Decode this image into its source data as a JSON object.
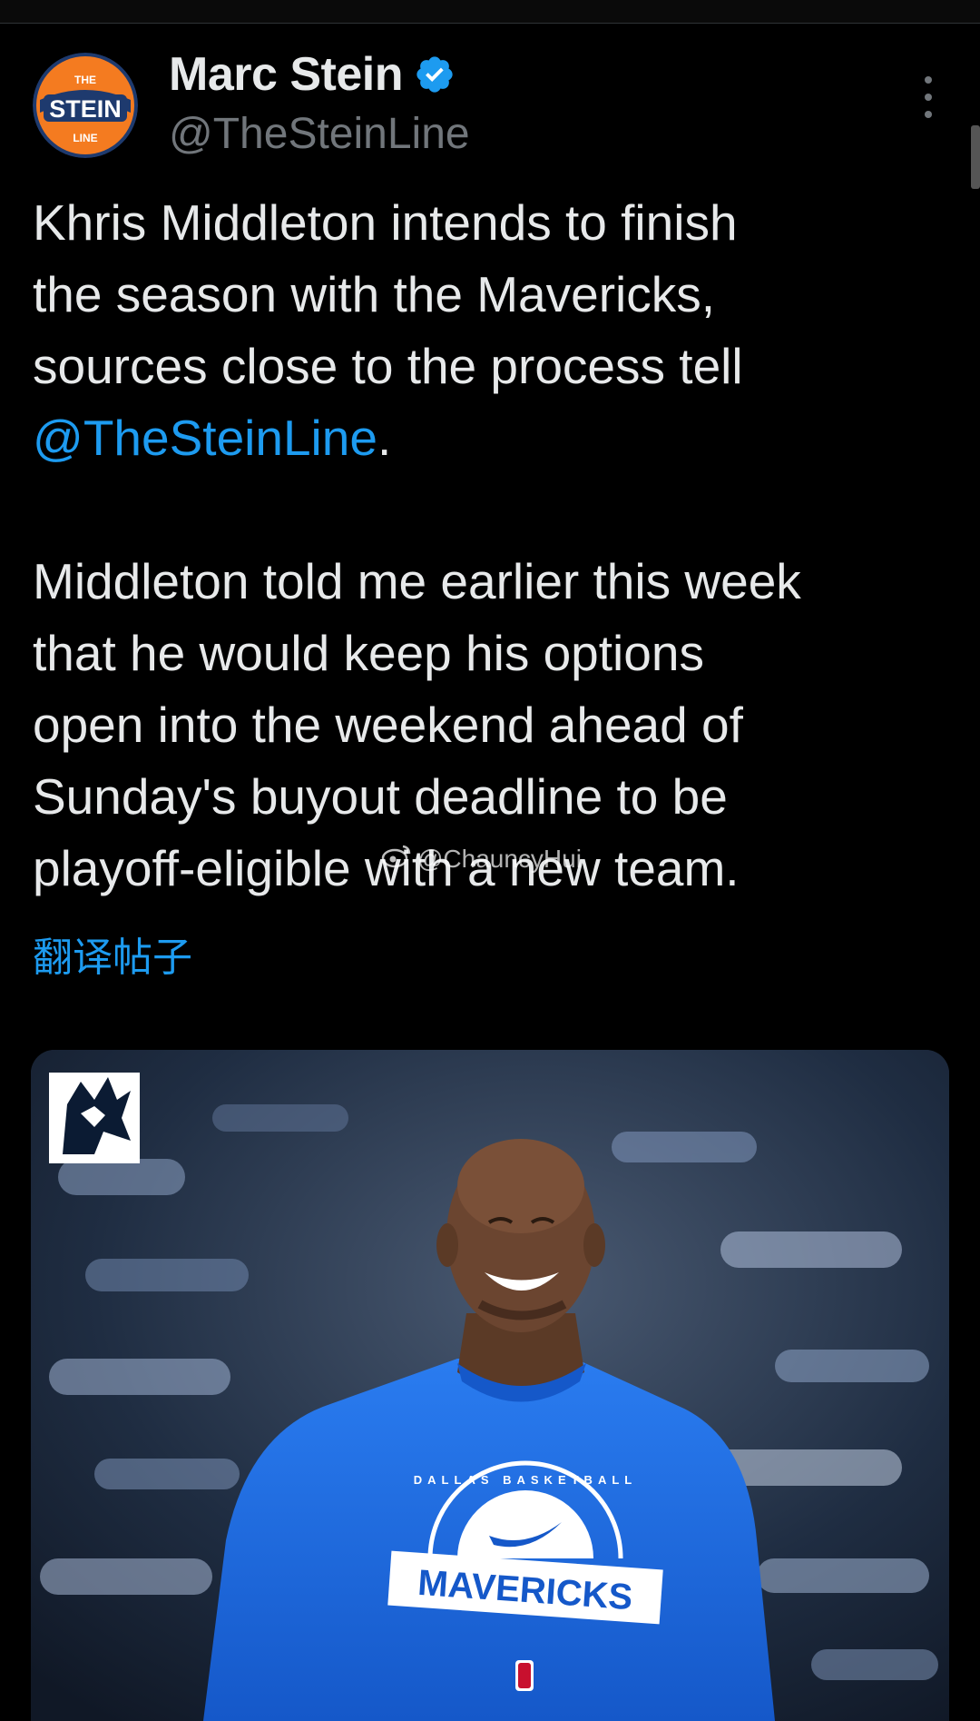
{
  "tweet": {
    "author": {
      "display_name": "Marc Stein",
      "handle": "@TheSteinLine",
      "avatar_lines": [
        "THE",
        "STEIN",
        "LINE"
      ]
    },
    "text": {
      "p1_line1": "Khris Middleton intends to finish",
      "p1_line2": "the season with the Mavericks,",
      "p1_line3": "sources close to the process tell",
      "p1_mention": "@TheSteinLine",
      "p1_end": ".",
      "p2_line1": "Middleton told me earlier this week",
      "p2_line2": "that he would keep his options",
      "p2_line3": "open into the weekend ahead of",
      "p2_line4": "Sunday's buyout deadline to be",
      "p2_line5": "playoff-eligible with a new team."
    },
    "translate_label": "翻译帖子",
    "watermark": "@ChauncyHui",
    "media": {
      "shirt_text": "MAVERICKS",
      "shirt_arc": "DALLAS BASKETBALL"
    }
  },
  "colors": {
    "background": "#000000",
    "text": "#e7e9ea",
    "secondary": "#71767b",
    "link": "#1d9bf0",
    "verified": "#1d9bf0",
    "shirt": "#1f6fe0"
  },
  "icons": [
    "verified-badge-icon",
    "more-options-icon",
    "weibo-icon",
    "mavericks-logo-icon"
  ]
}
